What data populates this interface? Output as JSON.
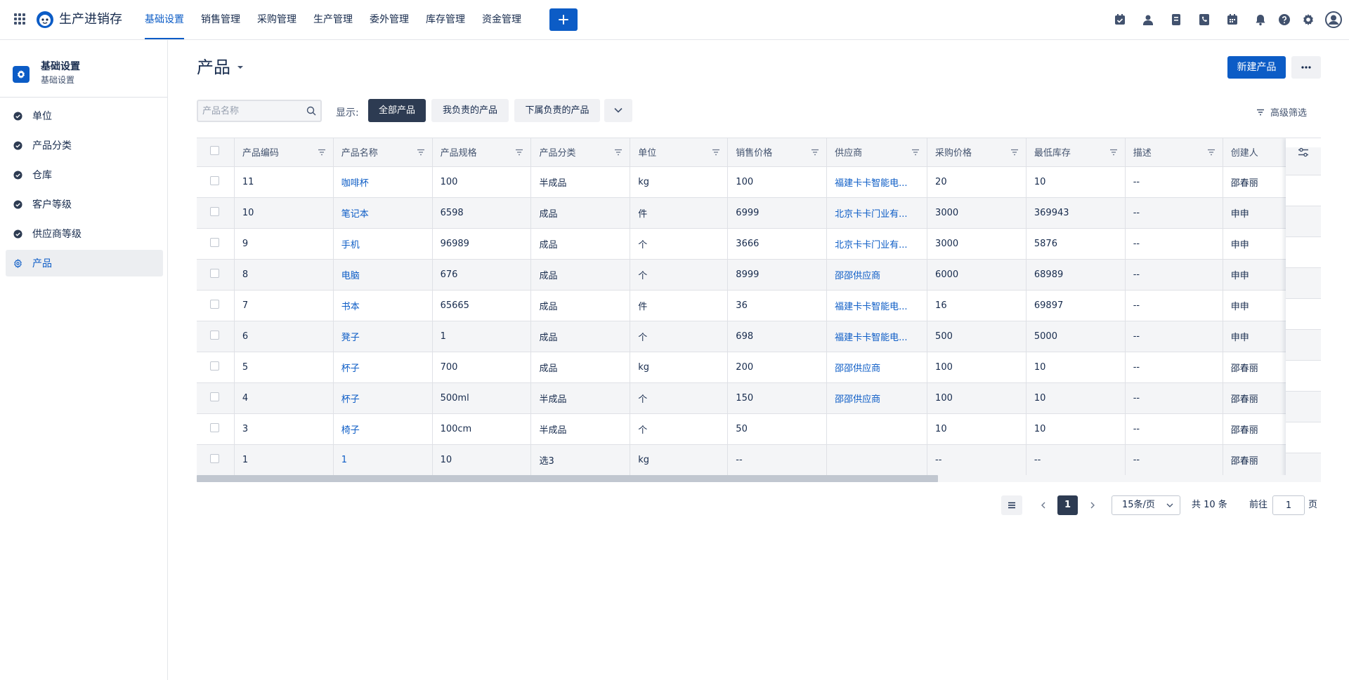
{
  "app": {
    "name": "生产进销存"
  },
  "nav": {
    "items": [
      {
        "label": "基础设置",
        "active": true
      },
      {
        "label": "销售管理",
        "active": false
      },
      {
        "label": "采购管理",
        "active": false
      },
      {
        "label": "生产管理",
        "active": false
      },
      {
        "label": "委外管理",
        "active": false
      },
      {
        "label": "库存管理",
        "active": false
      },
      {
        "label": "资金管理",
        "active": false
      }
    ],
    "right_icons": [
      "task-check-icon",
      "contacts-icon",
      "document-icon",
      "phone-icon",
      "calendar-icon",
      "bell-icon",
      "help-icon",
      "gear-icon",
      "avatar-icon"
    ]
  },
  "sidebar": {
    "title": "基础设置",
    "subtitle": "基础设置",
    "items": [
      {
        "label": "单位",
        "active": false
      },
      {
        "label": "产品分类",
        "active": false
      },
      {
        "label": "仓库",
        "active": false
      },
      {
        "label": "客户等级",
        "active": false
      },
      {
        "label": "供应商等级",
        "active": false
      },
      {
        "label": "产品",
        "active": true
      }
    ]
  },
  "page": {
    "title": "产品",
    "new_button": "新建产品"
  },
  "search": {
    "placeholder": "产品名称",
    "value": ""
  },
  "filters": {
    "show_label": "显示:",
    "options": [
      {
        "label": "全部产品",
        "active": true
      },
      {
        "label": "我负责的产品",
        "active": false
      },
      {
        "label": "下属负责的产品",
        "active": false
      }
    ],
    "advanced": "高级筛选"
  },
  "table": {
    "columns": [
      "产品编码",
      "产品名称",
      "产品规格",
      "产品分类",
      "单位",
      "销售价格",
      "供应商",
      "采购价格",
      "最低库存",
      "描述",
      "创建人"
    ],
    "rows": [
      [
        "11",
        "咖啡杯",
        "100",
        "半成品",
        "kg",
        "100",
        "福建卡卡智能电...",
        "20",
        "10",
        "--",
        "邵春丽"
      ],
      [
        "10",
        "笔记本",
        "6598",
        "成品",
        "件",
        "6999",
        "北京卡卡门业有...",
        "3000",
        "369943",
        "--",
        "申申"
      ],
      [
        "9",
        "手机",
        "96989",
        "成品",
        "个",
        "3666",
        "北京卡卡门业有...",
        "3000",
        "5876",
        "--",
        "申申"
      ],
      [
        "8",
        "电脑",
        "676",
        "成品",
        "个",
        "8999",
        "邵邵供应商",
        "6000",
        "68989",
        "--",
        "申申"
      ],
      [
        "7",
        "书本",
        "65665",
        "成品",
        "件",
        "36",
        "福建卡卡智能电...",
        "16",
        "69897",
        "--",
        "申申"
      ],
      [
        "6",
        "凳子",
        "1",
        "成品",
        "个",
        "698",
        "福建卡卡智能电...",
        "500",
        "5000",
        "--",
        "申申"
      ],
      [
        "5",
        "杯子",
        "700",
        "成品",
        "kg",
        "200",
        "邵邵供应商",
        "100",
        "10",
        "--",
        "邵春丽"
      ],
      [
        "4",
        "杯子",
        "500ml",
        "半成品",
        "个",
        "150",
        "邵邵供应商",
        "100",
        "10",
        "--",
        "邵春丽"
      ],
      [
        "3",
        "椅子",
        "100cm",
        "半成品",
        "个",
        "50",
        "",
        "10",
        "10",
        "--",
        "邵春丽"
      ],
      [
        "1",
        "1",
        "10",
        "选3",
        "kg",
        "--",
        "",
        "--",
        "--",
        "--",
        "邵春丽"
      ]
    ]
  },
  "pagination": {
    "current": "1",
    "page_size": "15条/页",
    "total": "共 10 条",
    "goto_label": "前往",
    "goto_value": "1",
    "goto_unit": "页"
  },
  "colors": {
    "primary": "#0c5cc6",
    "dark": "#2d3b52",
    "text": "#172b4d"
  }
}
